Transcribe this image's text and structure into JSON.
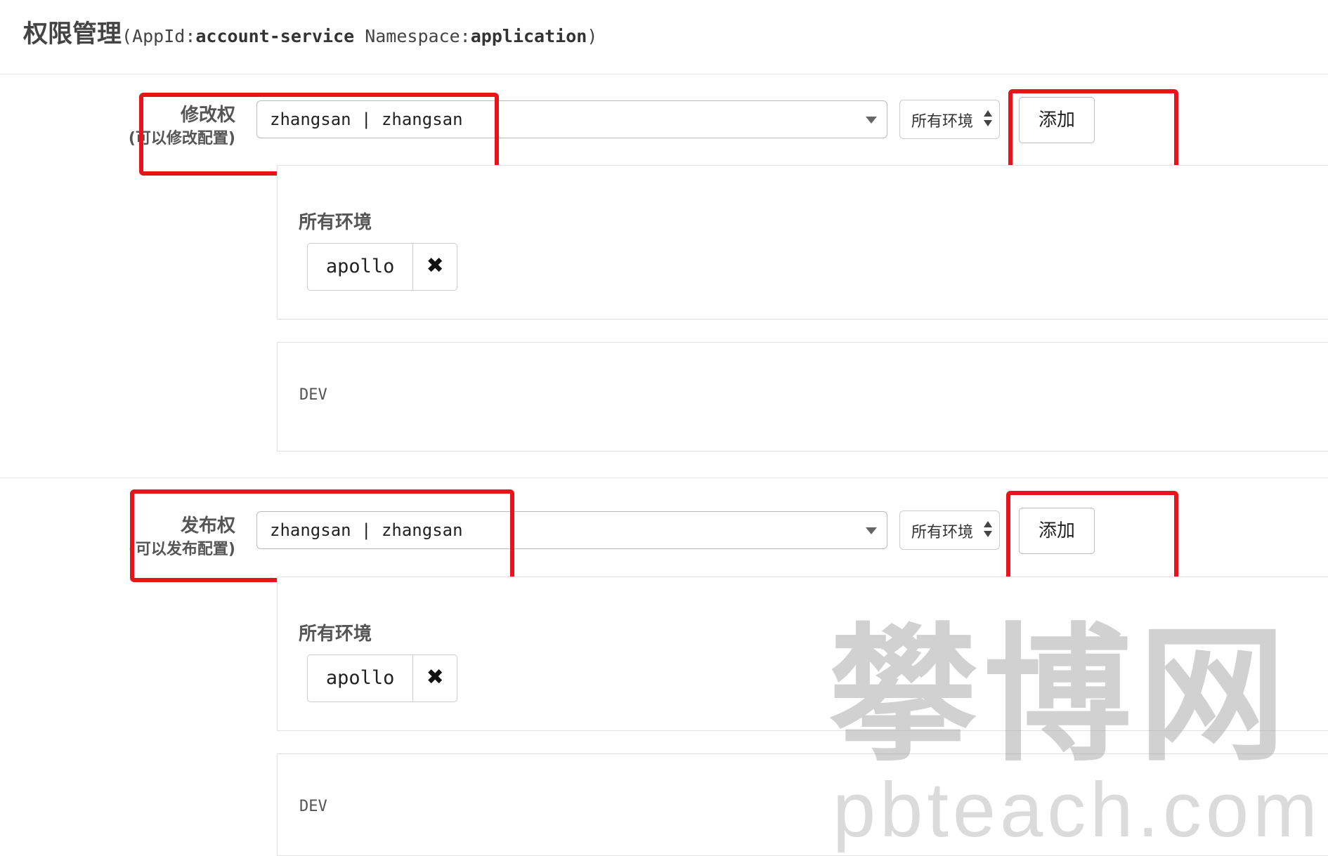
{
  "header": {
    "title": "权限管理",
    "meta_open": "(AppId:",
    "app_id": "account-service",
    "meta_mid": " Namespace:",
    "namespace": "application",
    "meta_close": ")"
  },
  "permissions": [
    {
      "name": "修改权",
      "description": "(可以修改配置)",
      "selected_user": "zhangsan | zhangsan",
      "env_option": "所有环境",
      "add_label": "添加",
      "assigned_env_heading": "所有环境",
      "assigned_users": [
        "apollo"
      ],
      "remove_icon": "✖",
      "env_code": "DEV"
    },
    {
      "name": "发布权",
      "description": "(可以发布配置)",
      "selected_user": "zhangsan | zhangsan",
      "env_option": "所有环境",
      "add_label": "添加",
      "assigned_env_heading": "所有环境",
      "assigned_users": [
        "apollo"
      ],
      "remove_icon": "✖",
      "env_code": "DEV"
    }
  ],
  "watermark": {
    "cn": "攀博网",
    "en": "pbteach.com"
  },
  "colors": {
    "highlight": "#e8141b"
  }
}
